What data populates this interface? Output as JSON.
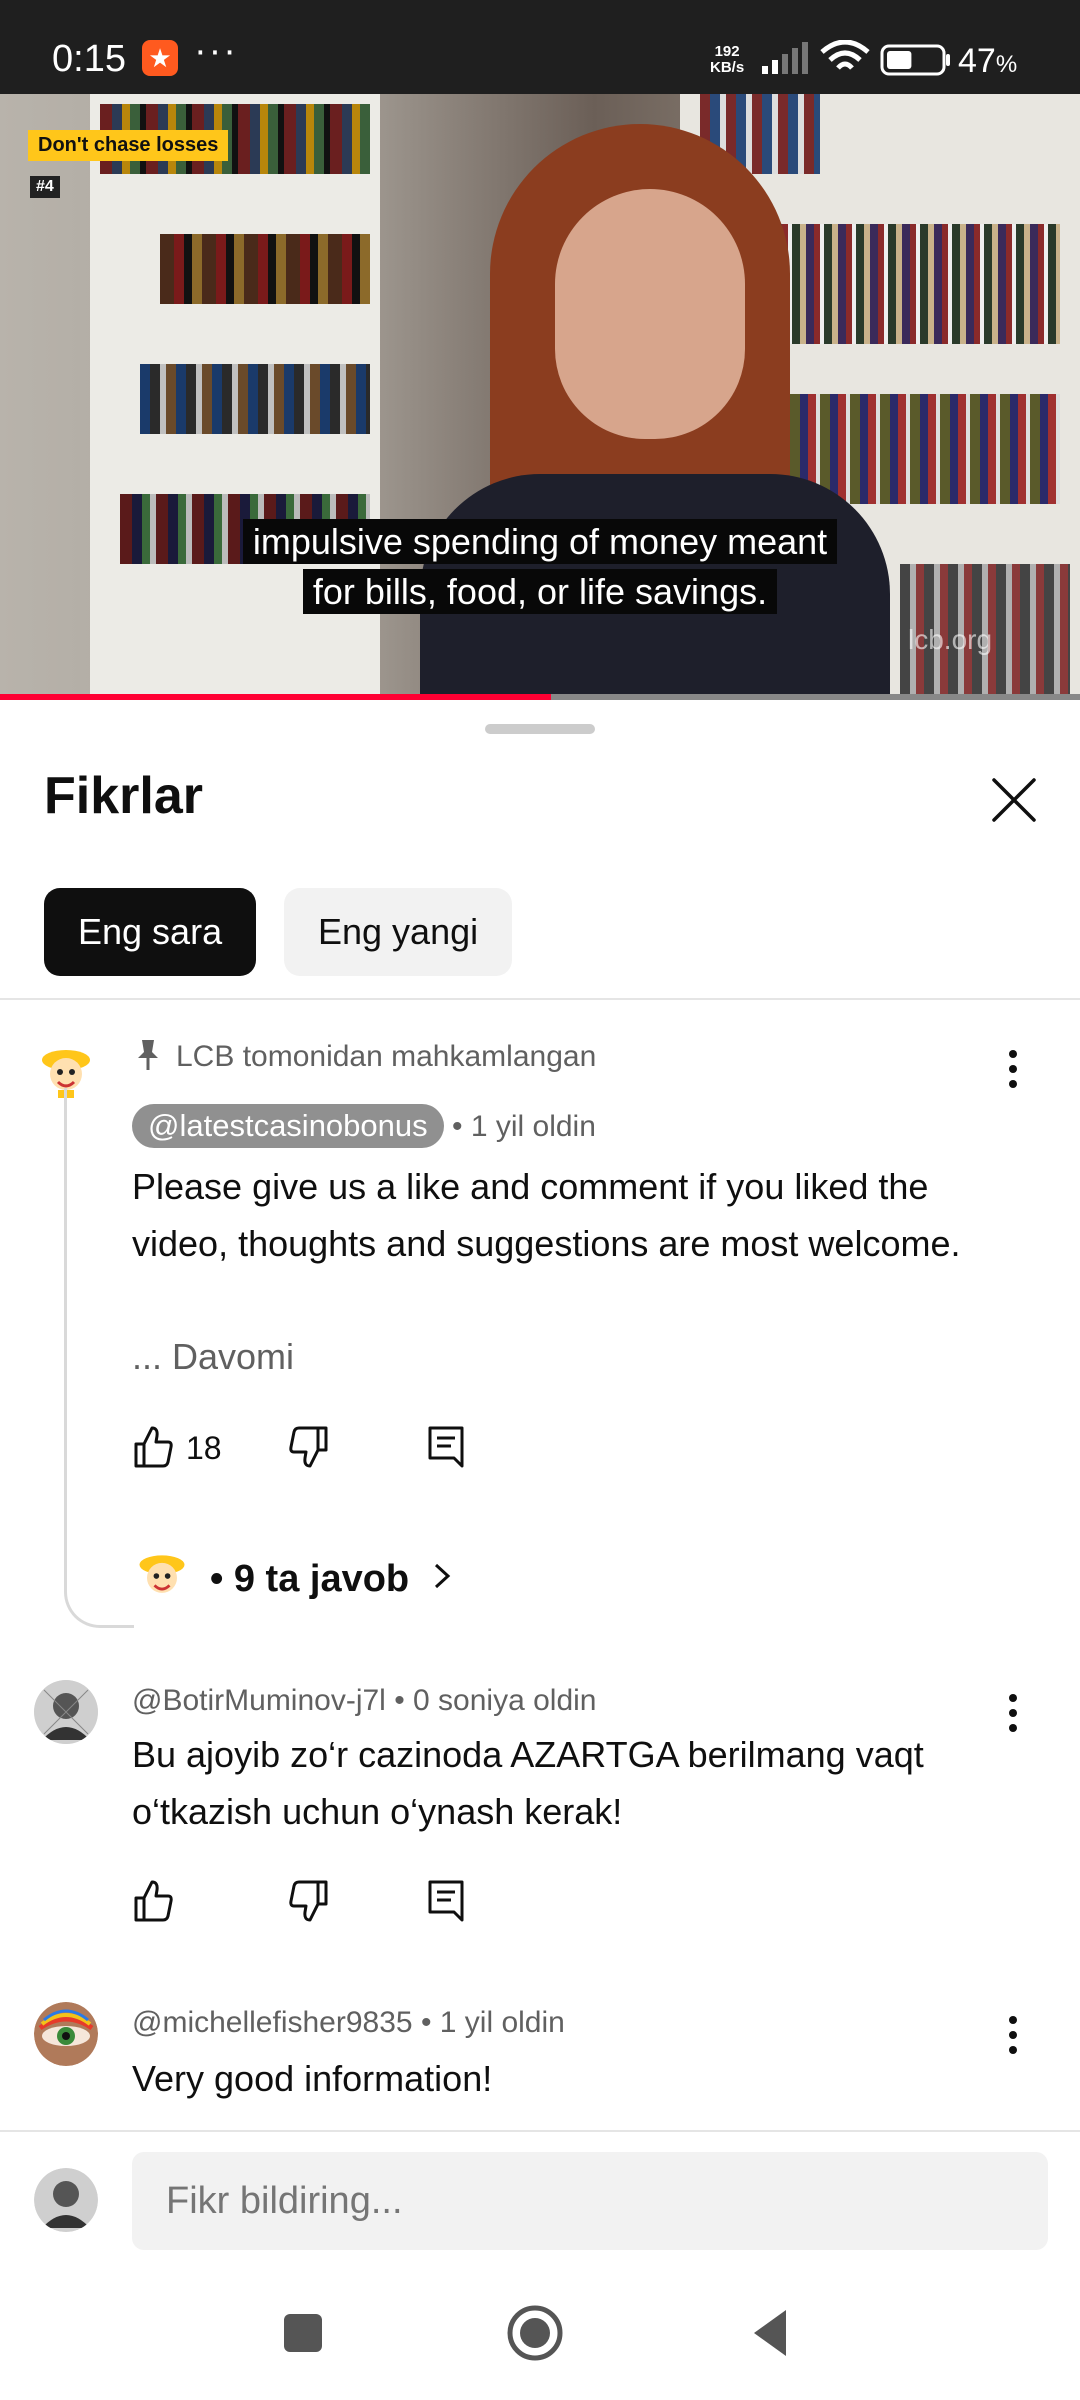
{
  "status_bar": {
    "time": "0:15",
    "more": "···",
    "net_speed_value": "192",
    "net_speed_unit": "KB/s",
    "battery_pct": "47",
    "battery_unit": "%"
  },
  "video": {
    "tag": "Don't chase losses",
    "tag_number": "#4",
    "caption_line1": "impulsive spending of money meant",
    "caption_line2": "for bills, food, or life savings.",
    "watermark": "lcb.org",
    "progress": 0.51
  },
  "comments_panel": {
    "title": "Fikrlar",
    "chips": [
      "Eng sara",
      "Eng yangi"
    ],
    "comments": [
      {
        "pinned_label": "LCB tomonidan mahkamlangan",
        "author": "@latestcasinobonus",
        "time": "• 1 yil oldin",
        "text": "Please give us a like and comment if you liked the video, thoughts and suggestions are most welcome.",
        "more": "... Davomi",
        "likes": "18",
        "replies": "• 9 ta javob"
      },
      {
        "author": "@BotirMuminov-j7l",
        "time": "• 0 soniya oldin",
        "text": "Bu ajoyib zo‘r cazinoda AZARTGA berilmang vaqt o‘tkazish uchun o‘ynash kerak!"
      },
      {
        "author": "@michellefisher9835",
        "time": "• 1 yil oldin",
        "text": "Very good information!"
      }
    ],
    "input_placeholder": "Fikr bildiring..."
  }
}
